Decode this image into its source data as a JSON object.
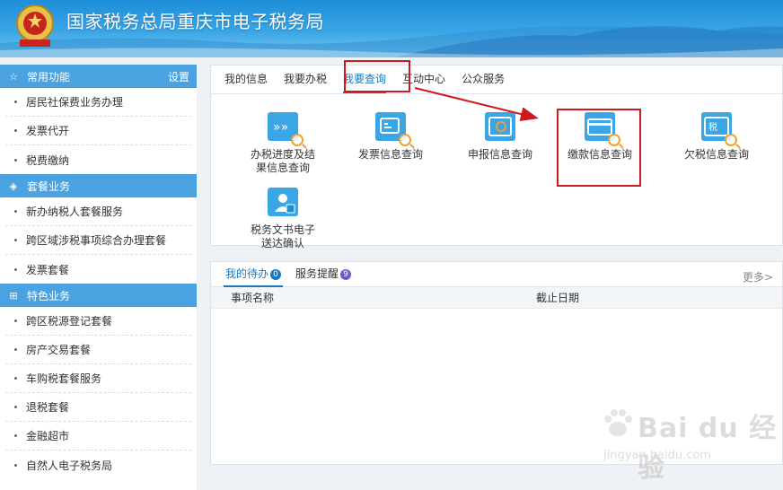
{
  "header": {
    "title": "国家税务总局重庆市电子税务局",
    "emblem_icon": "tax-emblem-icon"
  },
  "sidebar": {
    "sections": [
      {
        "title": "常用功能",
        "icon": "star-icon",
        "setting_label": "设置",
        "items": [
          "居民社保费业务办理",
          "发票代开",
          "税费缴纳"
        ]
      },
      {
        "title": "套餐业务",
        "icon": "layers-icon",
        "items": [
          "新办纳税人套餐服务",
          "跨区域涉税事项综合办理套餐",
          "发票套餐"
        ]
      },
      {
        "title": "特色业务",
        "icon": "grid-icon",
        "items": [
          "跨区税源登记套餐",
          "房产交易套餐",
          "车购税套餐服务",
          "退税套餐",
          "金融超市",
          "自然人电子税务局"
        ]
      }
    ]
  },
  "tabs": [
    {
      "label": "我的信息"
    },
    {
      "label": "我要办税"
    },
    {
      "label": "我要查询"
    },
    {
      "label": "互动中心"
    },
    {
      "label": "公众服务"
    }
  ],
  "tiles": [
    {
      "label": "办税进度及结果信息查询",
      "icon": "progress-query-icon"
    },
    {
      "label": "发票信息查询",
      "icon": "invoice-query-icon"
    },
    {
      "label": "申报信息查询",
      "icon": "declaration-query-icon"
    },
    {
      "label": "缴款信息查询",
      "icon": "payment-query-icon"
    },
    {
      "label": "欠税信息查询",
      "icon": "tax-arrears-query-icon"
    },
    {
      "label": "税务文书电子送达确认",
      "icon": "document-delivery-icon"
    }
  ],
  "todo": {
    "tabs": [
      {
        "label": "我的待办",
        "badge": "0"
      },
      {
        "label": "服务提醒",
        "badge": "9"
      }
    ],
    "more_label": "更多>",
    "columns": [
      "事项名称",
      "截止日期"
    ]
  },
  "watermark": {
    "text": "Bai du 经验",
    "url": "jingyan.baidu.com"
  },
  "colors": {
    "accent": "#1a78c2",
    "section_header": "#4aa3e0",
    "highlight": "#d0191f"
  }
}
